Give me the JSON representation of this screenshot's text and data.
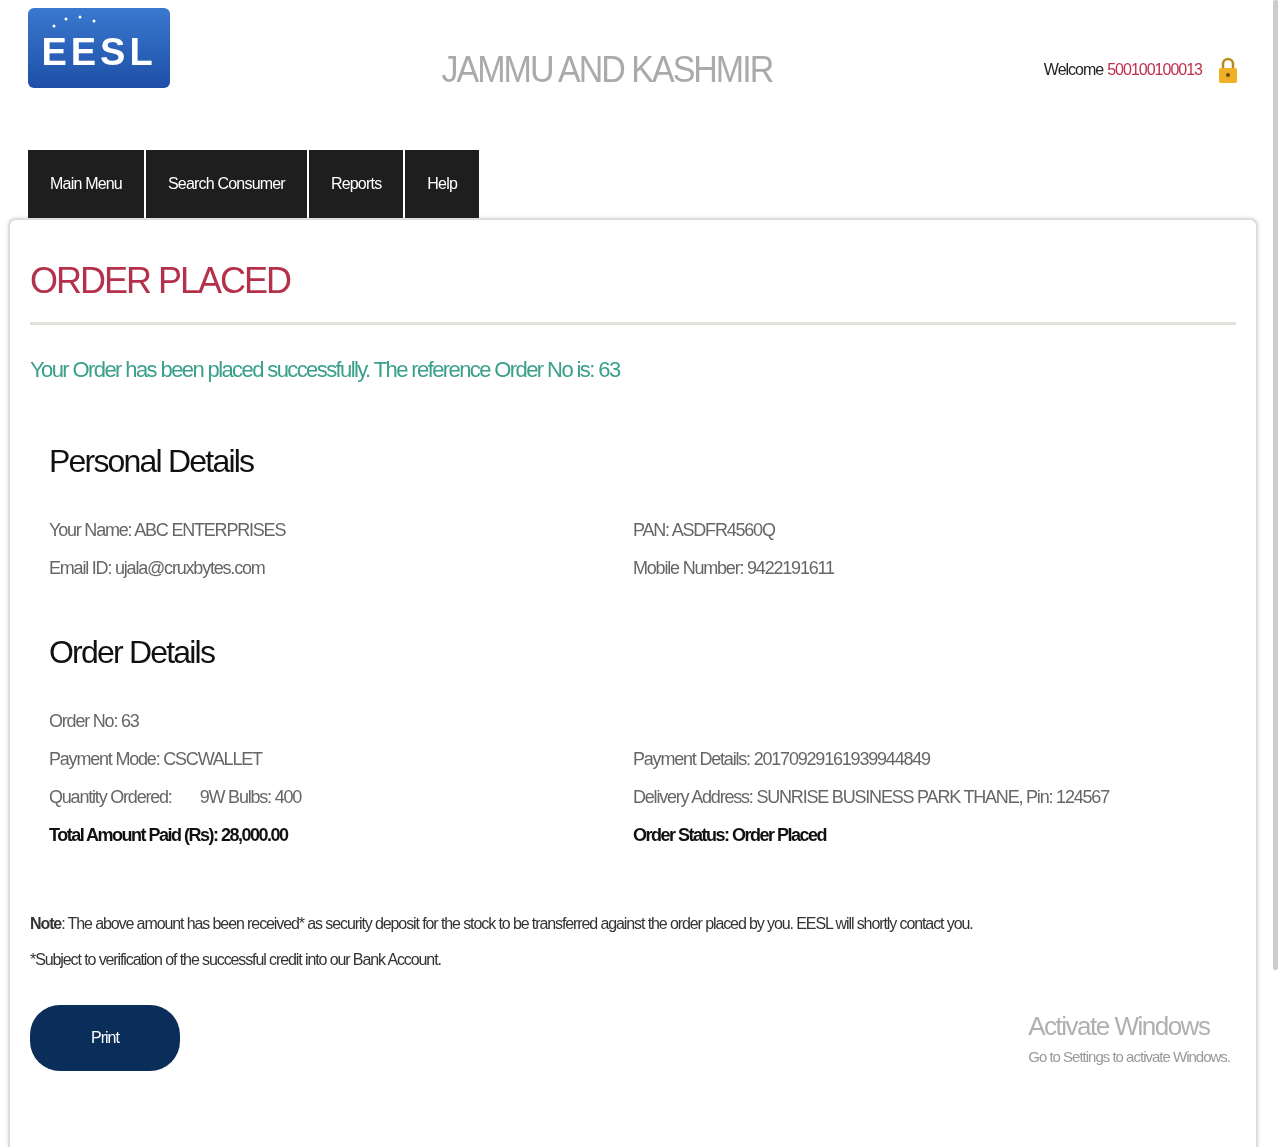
{
  "header": {
    "logo": "EESL",
    "title": "JAMMU AND KASHMIR",
    "welcome": "Welcome",
    "user": "500100100013"
  },
  "nav": [
    {
      "label": "Main Menu"
    },
    {
      "label": "Search Consumer"
    },
    {
      "label": "Reports"
    },
    {
      "label": "Help"
    }
  ],
  "page": {
    "heading": "ORDER PLACED",
    "message": "Your Order has been placed successfully. The reference Order No is: 63"
  },
  "sections": [
    {
      "title": "Personal Details",
      "left": [
        {
          "text": "Your Name: ABC ENTERPRISES",
          "bold": false
        },
        {
          "text": "Email ID: ujala@cruxbytes.com",
          "bold": false
        }
      ],
      "right": [
        {
          "text": "PAN: ASDFR4560Q",
          "bold": false
        },
        {
          "text": "Mobile Number: 9422191611",
          "bold": false
        }
      ]
    },
    {
      "title": "Order Details",
      "left": [
        {
          "text": "Order No: 63",
          "bold": false
        },
        {
          "text": "Payment Mode: CSCWALLET",
          "bold": false
        },
        {
          "text": "Quantity Ordered:",
          "extra": "9W Bulbs: 400",
          "bold": false
        },
        {
          "text": "Total Amount Paid (Rs): 28,000.00",
          "bold": true
        }
      ],
      "right": [
        {
          "text": "Payment Details: 20170929161939944849",
          "bold": false
        },
        {
          "text": "Delivery Address: SUNRISE BUSINESS PARK THANE, Pin: 124567",
          "bold": false
        },
        {
          "text": "Order Status: Order Placed",
          "bold": true
        }
      ]
    }
  ],
  "notes": [
    "**Note**: The above amount has been received* as security deposit for the stock to be transferred against the order placed by you. EESL will shortly contact you.",
    "*Subject to verification of the successful credit into our Bank Account."
  ],
  "print_button": "Print",
  "os_notice": {
    "title": "Activate Windows",
    "subtitle": "Go to Settings to activate Windows."
  }
}
